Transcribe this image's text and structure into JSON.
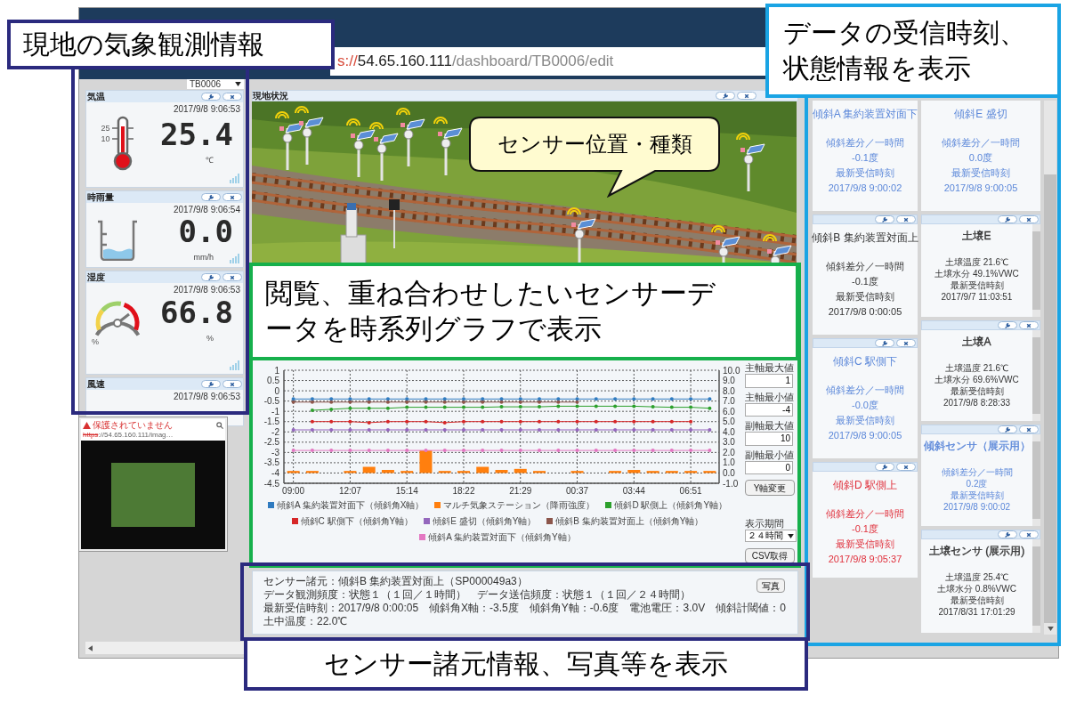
{
  "browser": {
    "url": {
      "scheme": "s://",
      "host": "54.65.160.111",
      "path": "/dashboard/TB0006/edit"
    }
  },
  "site_select": {
    "value": "TB0006"
  },
  "weather_widgets": [
    {
      "kind": "thermometer",
      "title": "気温",
      "timestamp": "2017/9/8 9:06:53",
      "value": "25.4",
      "unit": "℃",
      "scale_labels": [
        "25",
        "10"
      ]
    },
    {
      "kind": "rain_gauge",
      "title": "時雨量",
      "timestamp": "2017/9/8 9:06:54",
      "value": "0.0",
      "unit": "mm/h"
    },
    {
      "kind": "dial",
      "title": "湿度",
      "timestamp": "2017/9/8 9:06:53",
      "value": "66.8",
      "unit": "%",
      "dial_label": "%"
    },
    {
      "kind": "wind",
      "title": "風速",
      "timestamp": "2017/9/8 9:06:53"
    }
  ],
  "photo_popup": {
    "security": "保護されていません",
    "scheme": "https",
    "url_rest": "://54.65.160.111/imag…"
  },
  "scene_panel": {
    "title": "現地状況"
  },
  "chart_panel": {
    "chart_data": {
      "type": "line",
      "grid": true,
      "categories": [
        "09:00",
        null,
        null,
        "12:07",
        null,
        null,
        "15:14",
        null,
        null,
        "18:22",
        null,
        null,
        "21:29",
        null,
        null,
        "00:37",
        null,
        null,
        "03:44",
        null,
        null,
        "06:51",
        null
      ],
      "ylim": [
        -4.5,
        1
      ],
      "y2lim": [
        -1,
        10
      ],
      "yticks": [
        1,
        0.5,
        0,
        -0.5,
        -1,
        -1.5,
        -2,
        -2.5,
        -3,
        -3.5,
        -4,
        -4.5
      ],
      "y2ticks": [
        {
          "value": 10,
          "label": "10.0"
        },
        {
          "value": 9,
          "label": "9.0"
        },
        {
          "value": 8,
          "label": "8.0"
        },
        {
          "value": 7,
          "label": "7.0"
        },
        {
          "value": 6,
          "label": "6.0"
        },
        {
          "value": 5,
          "label": "5.0"
        },
        {
          "value": 4,
          "label": "4.0"
        },
        {
          "value": 3,
          "label": "3.0"
        },
        {
          "value": 2,
          "label": "2.0"
        },
        {
          "value": 1,
          "label": "1.0"
        },
        {
          "value": 0,
          "label": "0.0"
        },
        {
          "value": -1,
          "label": "-1.0"
        }
      ],
      "series": [
        {
          "name": "傾斜A 集約装置対面下（傾斜角X軸）",
          "color": "#2f7bc0",
          "values": [
            -0.4,
            -0.4,
            -0.4,
            -0.4,
            -0.4,
            -0.4,
            -0.4,
            -0.4,
            -0.4,
            -0.4,
            -0.4,
            -0.4,
            -0.4,
            -0.4,
            -0.4,
            -0.4,
            -0.4,
            -0.4,
            -0.4,
            -0.4,
            -0.4,
            -0.4,
            -0.4
          ]
        },
        {
          "name": "マルチ気象ステーション（降雨強度）",
          "color": "#ff7f0e",
          "type": "bar",
          "axis": "y2",
          "values": [
            0.2,
            0.2,
            null,
            0.2,
            0.6,
            0.3,
            0.2,
            2.2,
            0.2,
            0.2,
            0.6,
            0.3,
            0.4,
            0.2,
            null,
            0.2,
            null,
            0.2,
            0.3,
            0.2,
            0.2,
            0.2,
            0.2
          ]
        },
        {
          "name": "傾斜D 駅側上（傾斜角Y軸）",
          "color": "#2ca02c",
          "values": [
            null,
            -0.95,
            -0.9,
            -0.85,
            -0.85,
            -0.85,
            -0.8,
            -0.8,
            -0.8,
            -0.8,
            -0.8,
            -0.78,
            -0.78,
            -0.78,
            -0.75,
            -0.75,
            -0.75,
            -0.75,
            -0.75,
            -0.78,
            -0.8,
            -0.8,
            -0.85
          ]
        },
        {
          "name": "傾斜C 駅側下（傾斜角Y軸）",
          "color": "#d62728",
          "values": [
            null,
            -1.5,
            -1.5,
            -1.5,
            -1.55,
            -1.5,
            -1.5,
            -1.5,
            -1.55,
            -1.5,
            -1.5,
            -1.5,
            -1.5,
            -1.5,
            -1.5,
            -1.5,
            -1.5,
            -1.5,
            -1.5,
            -1.5,
            -1.5,
            -1.5,
            null
          ]
        },
        {
          "name": "傾斜E 盛切（傾斜角Y軸）",
          "color": "#9467bd",
          "values": [
            -1.9,
            -1.9,
            -1.9,
            -1.9,
            -1.9,
            -1.9,
            -1.9,
            -1.9,
            -1.9,
            -1.9,
            -1.9,
            -1.9,
            -1.9,
            -1.9,
            -1.9,
            -1.9,
            -1.9,
            -1.9,
            -1.9,
            -1.9,
            -1.9,
            -1.9,
            -1.9
          ]
        },
        {
          "name": "傾斜B 集約装置対面上（傾斜角Y軸）",
          "color": "#8c564b",
          "values": [
            -0.55,
            -0.55,
            -0.55,
            -0.55,
            -0.55,
            -0.55,
            -0.55,
            -0.55,
            -0.55,
            -0.55,
            -0.55,
            -0.55,
            -0.55,
            -0.55,
            -0.55,
            -0.55,
            null,
            null,
            null,
            null,
            null,
            null,
            null
          ]
        },
        {
          "name": "傾斜A 集約装置対面下（傾斜角Y軸）",
          "color": "#e377c2",
          "values": [
            -2.9,
            -2.9,
            -2.9,
            -2.9,
            -2.9,
            -2.9,
            -2.9,
            -2.9,
            -2.9,
            -2.9,
            -2.9,
            -2.9,
            -2.9,
            -2.9,
            -2.9,
            -2.9,
            -2.9,
            -2.9,
            -2.9,
            -2.9,
            -2.9,
            -2.9,
            -2.9
          ]
        }
      ]
    },
    "controls": {
      "fields": [
        {
          "label": "主軸最大値",
          "value": "1"
        },
        {
          "label": "主軸最小値",
          "value": "-4"
        },
        {
          "label": "副軸最大値",
          "value": "10"
        },
        {
          "label": "副軸最小値",
          "value": "0"
        }
      ],
      "apply_button": "Y軸変更",
      "period_label": "表示期間",
      "period_value": "２４時間",
      "csv_button": "CSV取得"
    }
  },
  "sensor_info": {
    "rows": [
      {
        "items": [
          "センサー諸元：傾斜B 集約装置対面上（SP000049a3）"
        ]
      },
      {
        "items": [
          "データ観測頻度：状態１（１回／１時間）",
          "データ送信頻度：状態１（１回／２４時間）"
        ]
      },
      {
        "items": [
          "最新受信時刻：2017/9/8 0:00:05",
          "傾斜角X軸：-3.5度",
          "傾斜角Y軸：-0.6度",
          "電池電圧：3.0V",
          "傾斜計閾値：0",
          "土中温度：22.0℃"
        ]
      }
    ],
    "photo_button": "写真"
  },
  "status_cards": {
    "columns": [
      {
        "cards": [
          {
            "kind": "tilt",
            "title": "傾斜A 集約装置対面下",
            "color": "#5b87d9",
            "toolbar": false,
            "lines": [
              "傾斜差分／一時間",
              "-0.1度",
              "最新受信時刻",
              "2017/9/8 9:00:02"
            ]
          },
          {
            "kind": "tilt",
            "title": "傾斜B 集約装置対面上",
            "color": "#333333",
            "toolbar": true,
            "lines": [
              "傾斜差分／一時間",
              "-0.1度",
              "最新受信時刻",
              "2017/9/8 0:00:05"
            ]
          },
          {
            "kind": "tilt",
            "title": "傾斜C 駅側下",
            "color": "#5b87d9",
            "toolbar": true,
            "lines": [
              "傾斜差分／一時間",
              "-0.0度",
              "最新受信時刻",
              "2017/9/8 9:00:05"
            ]
          },
          {
            "kind": "tilt",
            "title": "傾斜D 駅側上",
            "color": "#e0303c",
            "toolbar": true,
            "lines": [
              "傾斜差分／一時間",
              "-0.1度",
              "最新受信時刻",
              "2017/9/8 9:05:37"
            ]
          }
        ]
      },
      {
        "cards": [
          {
            "kind": "tilt",
            "title": "傾斜E 盛切",
            "color": "#5b87d9",
            "toolbar": false,
            "lines": [
              "傾斜差分／一時間",
              "0.0度",
              "最新受信時刻",
              "2017/9/8 9:00:05"
            ]
          },
          {
            "kind": "soil",
            "title": "土壌E",
            "color": "#333333",
            "toolbar": true,
            "lines": [
              "土壌温度 21.6℃",
              "土壌水分 49.1%VWC",
              "最新受信時刻",
              "2017/9/7 11:03:51"
            ]
          },
          {
            "kind": "soil",
            "title": "土壌A",
            "color": "#333333",
            "toolbar": true,
            "lines": [
              "土壌温度 21.6℃",
              "土壌水分 69.6%VWC",
              "最新受信時刻",
              "2017/9/8 8:28:33"
            ]
          },
          {
            "kind": "soil",
            "title": "傾斜センサ（展示用）",
            "color": "#5b87d9",
            "toolbar": true,
            "lines": [
              "傾斜差分／一時間",
              "0.2度",
              "最新受信時刻",
              "2017/9/8 9:00:02"
            ]
          },
          {
            "kind": "soil",
            "title": "土壌センサ (展示用)",
            "color": "#333333",
            "toolbar": true,
            "lines": [
              "土壌温度 25.4℃",
              "土壌水分 0.8%VWC",
              "最新受信時刻",
              "2017/8/31 17:01:29"
            ]
          }
        ]
      }
    ]
  },
  "annotations": [
    {
      "kind": "frame",
      "text": "現地の気象観測情報",
      "color": "#2b2a7e"
    },
    {
      "kind": "frame",
      "text": "データの受信時刻、状態情報を表示",
      "color": "#1aa4e4"
    },
    {
      "kind": "bubble",
      "text": "センサー位置・種類"
    },
    {
      "kind": "frame",
      "text": "閲覧、重ね合わせしたいセンサーデータを時系列グラフで表示",
      "color": "#16b04c"
    },
    {
      "kind": "frame",
      "text": "センサー諸元情報、写真等を表示",
      "color": "#2b2a7e"
    }
  ]
}
